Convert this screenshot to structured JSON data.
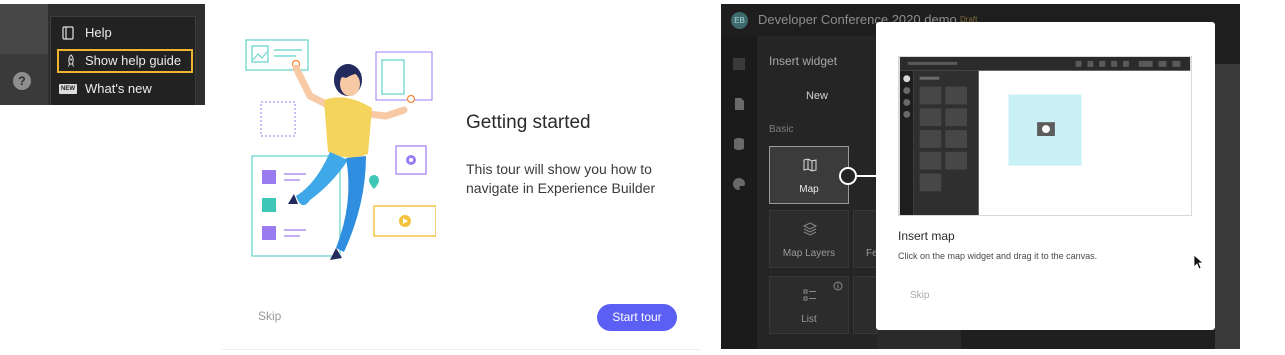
{
  "help_menu": {
    "rail_help_glyph": "?",
    "items": [
      {
        "label": "Help",
        "icon": "book-icon"
      },
      {
        "label": "Show help guide",
        "icon": "rocket-icon",
        "highlighted": true
      },
      {
        "label": "What's new",
        "icon": "new-badge-icon",
        "badge": "NEW"
      }
    ],
    "highlight_color": "#f0b52e"
  },
  "getting_started": {
    "title": "Getting started",
    "description": "This tour will show you how to navigate in Experience Builder",
    "skip_label": "Skip",
    "start_label": "Start tour",
    "accent_color": "#5b5ff4"
  },
  "builder": {
    "app_title": "Developer Conference 2020 demo",
    "status_badge": "Draft",
    "insert_panel_title": "Insert widget",
    "tab_new": "New",
    "section_basic": "Basic",
    "widgets": [
      {
        "label": "Map",
        "icon": "map-icon",
        "selected": true
      },
      {
        "label": "Map Layers",
        "icon": "layers-icon"
      },
      {
        "label": "Fe",
        "icon": "feature-icon"
      },
      {
        "label": "List",
        "icon": "list-icon"
      }
    ],
    "tip": {
      "title": "Insert map",
      "description": "Click on the map widget and drag it to the canvas.",
      "skip_label": "Skip"
    }
  }
}
